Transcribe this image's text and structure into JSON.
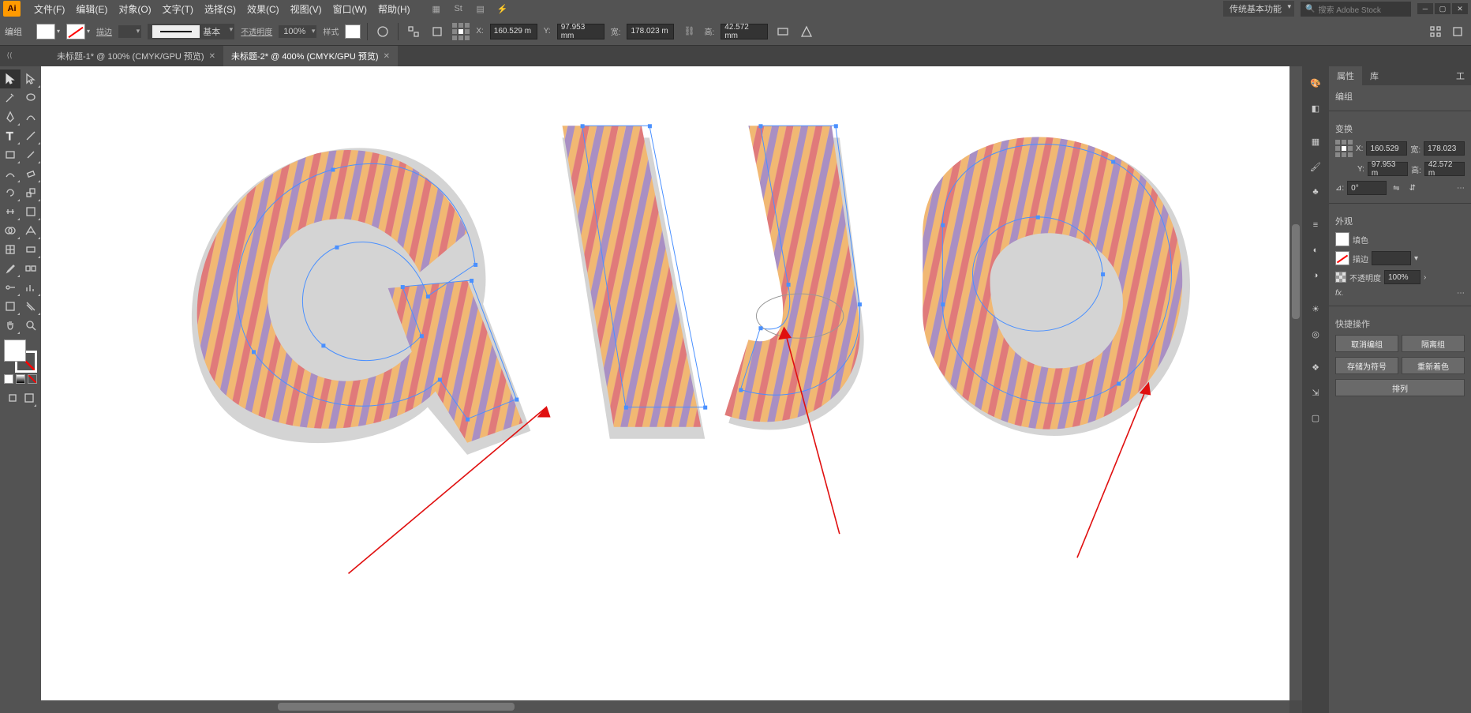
{
  "menubar": {
    "items": [
      "文件(F)",
      "编辑(E)",
      "对象(O)",
      "文字(T)",
      "选择(S)",
      "效果(C)",
      "视图(V)",
      "窗口(W)",
      "帮助(H)"
    ],
    "workspace": "传统基本功能",
    "search_placeholder": "搜索 Adobe Stock"
  },
  "controlbar": {
    "label": "编组",
    "stroke_label": "描边",
    "stroke_dash": "",
    "stroke_style_label": "基本",
    "opacity_label": "不透明度",
    "opacity_value": "100%",
    "style_label": "样式",
    "x_label": "X:",
    "y_label": "Y:",
    "w_label": "宽:",
    "h_label": "高:",
    "x": "160.529 m",
    "y": "97.953 mm",
    "w": "178.023 m",
    "h": "42.572 mm"
  },
  "tabs": [
    {
      "label": "未标题-1* @ 100% (CMYK/GPU 预览)",
      "active": false
    },
    {
      "label": "未标题-2* @ 400% (CMYK/GPU 预览)",
      "active": true
    }
  ],
  "properties": {
    "tab_props": "属性",
    "tab_lib": "库",
    "group_label": "编组",
    "transform_label": "变换",
    "x_label": "X:",
    "y_label": "Y:",
    "w_label": "宽:",
    "h_label": "高:",
    "x": "160.529",
    "y": "97.953 m",
    "w": "178.023",
    "h": "42.572 m",
    "rotate_label": "⊿:",
    "rotate": "0°",
    "appearance_label": "外观",
    "fill_label": "填色",
    "stroke_label": "描边",
    "opacity_label": "不透明度",
    "opacity_value": "100%",
    "fx_label": "fx.",
    "quick_label": "快捷操作",
    "btn_ungroup": "取消编组",
    "btn_isolate": "隔离组",
    "btn_save_symbol": "存储为符号",
    "btn_recolor": "重新着色",
    "btn_arrange": "排列",
    "more_label": "工"
  }
}
